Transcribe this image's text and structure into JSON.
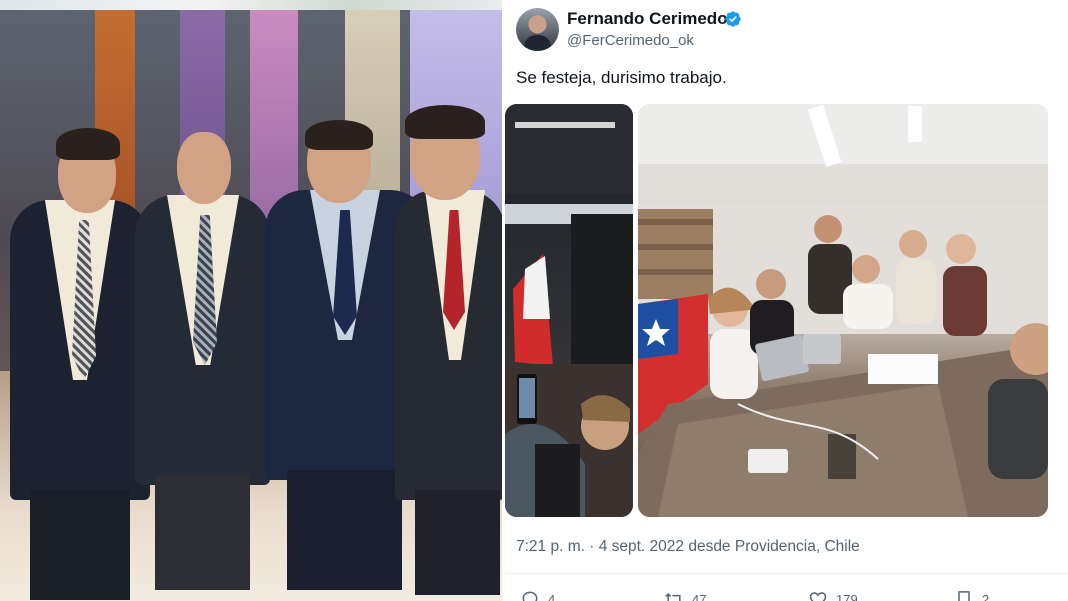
{
  "tweet": {
    "display_name": "Fernando Cerimedo",
    "handle": "@FerCerimedo_ok",
    "text": "Se festeja, durisimo trabajo.",
    "timestamp": "7:21 p. m. · 4 sept. 2022 desde Providencia, Chile",
    "verified": true,
    "accent_color": "#1d9bf0",
    "actions": [
      {
        "name": "reply",
        "icon": "reply-icon",
        "count": "4"
      },
      {
        "name": "retweet",
        "icon": "retweet-icon",
        "count": "47"
      },
      {
        "name": "like",
        "icon": "heart-icon",
        "count": "179"
      },
      {
        "name": "bookmark",
        "icon": "bookmark-icon",
        "count": "2"
      }
    ]
  }
}
